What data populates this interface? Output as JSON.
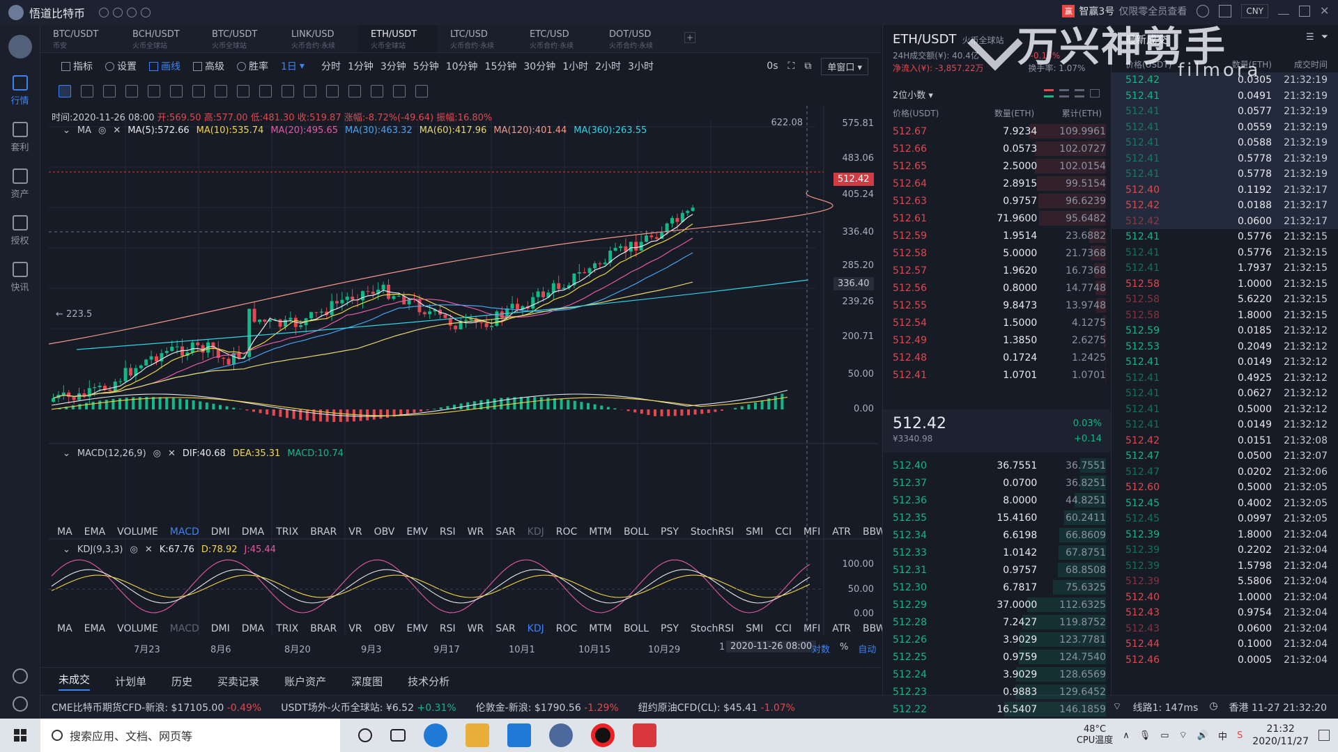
{
  "titlebar": {
    "app_name": "悟道比特币",
    "promo_name": "智赢3号",
    "promo_sub": "仅限零全员查看",
    "promo_badge": "赢",
    "currency": "CNY"
  },
  "leftnav": {
    "items": [
      {
        "label": "行情",
        "icon": "market-icon",
        "active": true
      },
      {
        "label": "套利",
        "icon": "arbitrage-icon",
        "active": false
      },
      {
        "label": "资产",
        "icon": "assets-icon",
        "active": false
      },
      {
        "label": "授权",
        "icon": "authorize-icon",
        "active": false
      },
      {
        "label": "快讯",
        "icon": "news-icon",
        "active": false
      }
    ]
  },
  "pair_tabs": [
    {
      "name": "BTC/USDT",
      "sub": "币安"
    },
    {
      "name": "BCH/USDT",
      "sub": "火币全球站"
    },
    {
      "name": "BTC/USDT",
      "sub": "火币全球站"
    },
    {
      "name": "LINK/USD",
      "sub": "火币合约·永续"
    },
    {
      "name": "ETH/USDT",
      "sub": "火币全球站",
      "active": true
    },
    {
      "name": "LTC/USD",
      "sub": "火币合约·永续"
    },
    {
      "name": "ETC/USD",
      "sub": "火币合约·永续"
    },
    {
      "name": "DOT/USD",
      "sub": "火币合约·永续"
    }
  ],
  "pair_add_label": "+",
  "toolbar": {
    "indicator": "指标",
    "settings": "设置",
    "draw": "画线",
    "advanced": "高级",
    "winrate": "胜率",
    "period": "1日",
    "intervals": [
      "分时",
      "1分钟",
      "3分钟",
      "5分钟",
      "10分钟",
      "15分钟",
      "30分钟",
      "1小时",
      "2小时",
      "3小时"
    ],
    "countdown": "0s",
    "window_mode": "单窗口"
  },
  "chart": {
    "info": {
      "time": "时间:2020-11-26 08:00",
      "open": "开:569.50",
      "high": "高:577.00",
      "low": "低:481.30",
      "close": "收:519.87",
      "change": "涨幅:-8.72%(-49.64)",
      "amplitude": "振幅:16.80%"
    },
    "ma": {
      "label": "MA",
      "values": [
        {
          "text": "MA(5):572.66",
          "color": "#e8eaf0"
        },
        {
          "text": "MA(10):535.74",
          "color": "#f5d742"
        },
        {
          "text": "MA(20):495.65",
          "color": "#e45ba6"
        },
        {
          "text": "MA(30):463.32",
          "color": "#4aa3f0"
        },
        {
          "text": "MA(60):417.96",
          "color": "#e9d86b"
        },
        {
          "text": "MA(120):401.44",
          "color": "#f39b8b"
        },
        {
          "text": "MA(360):263.55",
          "color": "#2fd6e6"
        }
      ]
    },
    "price_axis": [
      "575.81",
      "483.06",
      "405.24",
      "336.40",
      "285.20",
      "239.26",
      "200.71"
    ],
    "high_mark": "622.08",
    "low_mark": "223.5",
    "last_price_tag": "512.42",
    "crosshair_price": "336.40",
    "macd": {
      "label": "MACD(12,26,9)",
      "dif": "DIF:40.68",
      "dea": "DEA:35.31",
      "macd": "MACD:10.74",
      "axis": [
        "50.00",
        "0.00"
      ]
    },
    "kdj": {
      "label": "KDJ(9,3,3)",
      "k": "K:67.76",
      "d": "D:78.92",
      "j": "J:45.44",
      "axis": [
        "100.00",
        "50.00",
        "0.00"
      ]
    },
    "indicator_tabs": [
      "MA",
      "EMA",
      "VOLUME",
      "MACD",
      "DMI",
      "DMA",
      "TRIX",
      "BRAR",
      "VR",
      "OBV",
      "EMV",
      "RSI",
      "WR",
      "SAR",
      "KDJ",
      "ROC",
      "MTM",
      "BOLL",
      "PSY",
      "StochRSI",
      "SMI",
      "CCI",
      "MFI",
      "ATR",
      "BBW"
    ],
    "dates": [
      "7月23",
      "8月6",
      "8月20",
      "9月3",
      "9月17",
      "10月1",
      "10月15",
      "10月29",
      "1"
    ],
    "date_tag": "2020-11-26 08:00",
    "date_right": [
      "对数",
      "%",
      "自动"
    ]
  },
  "bottom_tabs": [
    "未成交",
    "计划单",
    "历史",
    "买卖记录",
    "账户资产",
    "深度图",
    "技术分析"
  ],
  "ticker": [
    {
      "name": "CME比特币期货CFD-新浪:",
      "price": "$17105.00",
      "change": "-0.49%",
      "dir": "down"
    },
    {
      "name": "USDT场外-火币全球站:",
      "price": "¥6.52",
      "change": "+0.31%",
      "dir": "up"
    },
    {
      "name": "伦敦金-新浪:",
      "price": "$1790.56",
      "change": "-1.29%",
      "dir": "down"
    },
    {
      "name": "纽约原油CFD(CL):",
      "price": "$45.41",
      "change": "-1.07%",
      "dir": "down"
    }
  ],
  "ticker_right": {
    "line": "线路1: 147ms",
    "clock": "香港 11-27 21:32:20"
  },
  "orderbook": {
    "title": "ETH/USDT",
    "exchange": "火币全球站",
    "vol24": "24H成交额(¥): 40.4亿",
    "netflow": "净流入(¥): -3,857.22万",
    "pct_a": "-0.15%",
    "turnover": "换手率: 1.07%",
    "decimals": "2位小数",
    "cols": [
      "价格(USDT)",
      "数量(ETH)",
      "累计(ETH)"
    ],
    "asks": [
      {
        "p": "512.67",
        "q": "7.9234",
        "c": "109.9961"
      },
      {
        "p": "512.66",
        "q": "0.0573",
        "c": "102.0727"
      },
      {
        "p": "512.65",
        "q": "2.5000",
        "c": "102.0154"
      },
      {
        "p": "512.64",
        "q": "2.8915",
        "c": "99.5154"
      },
      {
        "p": "512.63",
        "q": "0.9757",
        "c": "96.6239"
      },
      {
        "p": "512.61",
        "q": "71.9600",
        "c": "95.6482"
      },
      {
        "p": "512.59",
        "q": "1.9514",
        "c": "23.6882"
      },
      {
        "p": "512.58",
        "q": "5.0000",
        "c": "21.7368"
      },
      {
        "p": "512.57",
        "q": "1.9620",
        "c": "16.7368"
      },
      {
        "p": "512.56",
        "q": "0.8000",
        "c": "14.7748"
      },
      {
        "p": "512.55",
        "q": "9.8473",
        "c": "13.9748"
      },
      {
        "p": "512.54",
        "q": "1.5000",
        "c": "4.1275"
      },
      {
        "p": "512.49",
        "q": "1.3850",
        "c": "2.6275"
      },
      {
        "p": "512.48",
        "q": "0.1724",
        "c": "1.2425"
      },
      {
        "p": "512.41",
        "q": "1.0701",
        "c": "1.0701"
      }
    ],
    "mid_price": "512.42",
    "mid_cny": "¥3340.98",
    "mid_pct": "0.03%",
    "mid_chg": "+0.14",
    "bids": [
      {
        "p": "512.40",
        "q": "36.7551",
        "c": "36.7551"
      },
      {
        "p": "512.37",
        "q": "0.0700",
        "c": "36.8251"
      },
      {
        "p": "512.36",
        "q": "8.0000",
        "c": "44.8251"
      },
      {
        "p": "512.35",
        "q": "15.4160",
        "c": "60.2411"
      },
      {
        "p": "512.34",
        "q": "6.6198",
        "c": "66.8609"
      },
      {
        "p": "512.33",
        "q": "1.0142",
        "c": "67.8751"
      },
      {
        "p": "512.31",
        "q": "0.9757",
        "c": "68.8508"
      },
      {
        "p": "512.30",
        "q": "6.7817",
        "c": "75.6325"
      },
      {
        "p": "512.29",
        "q": "37.0000",
        "c": "112.6325"
      },
      {
        "p": "512.28",
        "q": "7.2427",
        "c": "119.8752"
      },
      {
        "p": "512.26",
        "q": "3.9029",
        "c": "123.7781"
      },
      {
        "p": "512.25",
        "q": "0.9759",
        "c": "124.7540"
      },
      {
        "p": "512.24",
        "q": "3.9029",
        "c": "128.6569"
      },
      {
        "p": "512.23",
        "q": "0.9883",
        "c": "129.6452"
      },
      {
        "p": "512.22",
        "q": "16.5407",
        "c": "146.1859"
      }
    ]
  },
  "trades": {
    "title": "最新成交",
    "cols": [
      "价格(USDT)",
      "数量(ETH)",
      "成交时间"
    ],
    "rows": [
      {
        "p": "512.42",
        "q": "0.0305",
        "t": "21:32:19",
        "s": "buy",
        "hl": true
      },
      {
        "p": "512.41",
        "q": "0.0491",
        "t": "21:32:19",
        "s": "buy",
        "hl": true
      },
      {
        "p": "512.41",
        "q": "0.0577",
        "t": "21:32:19",
        "s": "buy",
        "hl": true,
        "dim": true
      },
      {
        "p": "512.41",
        "q": "0.0559",
        "t": "21:32:19",
        "s": "buy",
        "hl": true,
        "dim": true
      },
      {
        "p": "512.41",
        "q": "0.0588",
        "t": "21:32:19",
        "s": "buy",
        "hl": true,
        "dim": true
      },
      {
        "p": "512.41",
        "q": "0.5778",
        "t": "21:32:19",
        "s": "buy",
        "hl": true,
        "dim": true
      },
      {
        "p": "512.41",
        "q": "0.5778",
        "t": "21:32:19",
        "s": "buy",
        "hl": true,
        "dim": true
      },
      {
        "p": "512.40",
        "q": "0.1192",
        "t": "21:32:17",
        "s": "sell",
        "hl": true
      },
      {
        "p": "512.42",
        "q": "0.0188",
        "t": "21:32:17",
        "s": "sell",
        "hl": true
      },
      {
        "p": "512.42",
        "q": "0.0600",
        "t": "21:32:17",
        "s": "sell",
        "hl": true,
        "dim": true
      },
      {
        "p": "512.41",
        "q": "0.5776",
        "t": "21:32:15",
        "s": "buy"
      },
      {
        "p": "512.41",
        "q": "0.5776",
        "t": "21:32:15",
        "s": "buy",
        "dim": true
      },
      {
        "p": "512.41",
        "q": "1.7937",
        "t": "21:32:15",
        "s": "buy",
        "dim": true
      },
      {
        "p": "512.58",
        "q": "1.0000",
        "t": "21:32:15",
        "s": "sell"
      },
      {
        "p": "512.58",
        "q": "5.6220",
        "t": "21:32:15",
        "s": "sell",
        "dim": true
      },
      {
        "p": "512.58",
        "q": "1.8000",
        "t": "21:32:15",
        "s": "sell",
        "dim": true
      },
      {
        "p": "512.59",
        "q": "0.0185",
        "t": "21:32:12",
        "s": "buy"
      },
      {
        "p": "512.53",
        "q": "0.2049",
        "t": "21:32:12",
        "s": "buy"
      },
      {
        "p": "512.41",
        "q": "0.0149",
        "t": "21:32:12",
        "s": "buy"
      },
      {
        "p": "512.41",
        "q": "0.4925",
        "t": "21:32:12",
        "s": "buy",
        "dim": true
      },
      {
        "p": "512.41",
        "q": "0.0627",
        "t": "21:32:12",
        "s": "buy",
        "dim": true
      },
      {
        "p": "512.41",
        "q": "0.5000",
        "t": "21:32:12",
        "s": "buy",
        "dim": true
      },
      {
        "p": "512.41",
        "q": "0.0149",
        "t": "21:32:12",
        "s": "buy",
        "dim": true
      },
      {
        "p": "512.42",
        "q": "0.0151",
        "t": "21:32:08",
        "s": "sell"
      },
      {
        "p": "512.47",
        "q": "0.0500",
        "t": "21:32:07",
        "s": "buy"
      },
      {
        "p": "512.47",
        "q": "0.0202",
        "t": "21:32:06",
        "s": "buy",
        "dim": true
      },
      {
        "p": "512.60",
        "q": "0.5000",
        "t": "21:32:05",
        "s": "sell"
      },
      {
        "p": "512.45",
        "q": "0.4002",
        "t": "21:32:05",
        "s": "buy"
      },
      {
        "p": "512.45",
        "q": "0.0997",
        "t": "21:32:05",
        "s": "buy",
        "dim": true
      },
      {
        "p": "512.39",
        "q": "1.8000",
        "t": "21:32:04",
        "s": "buy"
      },
      {
        "p": "512.39",
        "q": "0.2202",
        "t": "21:32:04",
        "s": "buy",
        "dim": true
      },
      {
        "p": "512.39",
        "q": "1.5798",
        "t": "21:32:04",
        "s": "buy",
        "dim": true
      },
      {
        "p": "512.39",
        "q": "5.5806",
        "t": "21:32:04",
        "s": "sell",
        "dim": true
      },
      {
        "p": "512.40",
        "q": "1.0000",
        "t": "21:32:04",
        "s": "sell"
      },
      {
        "p": "512.43",
        "q": "0.9754",
        "t": "21:32:04",
        "s": "sell"
      },
      {
        "p": "512.43",
        "q": "0.0600",
        "t": "21:32:04",
        "s": "sell",
        "dim": true
      },
      {
        "p": "512.44",
        "q": "0.1000",
        "t": "21:32:04",
        "s": "sell"
      },
      {
        "p": "512.46",
        "q": "0.0005",
        "t": "21:32:04",
        "s": "sell"
      }
    ]
  },
  "watermark": {
    "big": "万兴神剪手",
    "small": "filmora"
  },
  "taskbar": {
    "search_placeholder": "搜索应用、文档、网页等",
    "cpu_temp": "48°C",
    "cpu_label": "CPU温度",
    "time": "21:32",
    "date": "2020/11/27"
  },
  "colors": {
    "up": "#12b886",
    "down": "#e2484e",
    "accent": "#3d83f5",
    "bg": "#161b26"
  }
}
